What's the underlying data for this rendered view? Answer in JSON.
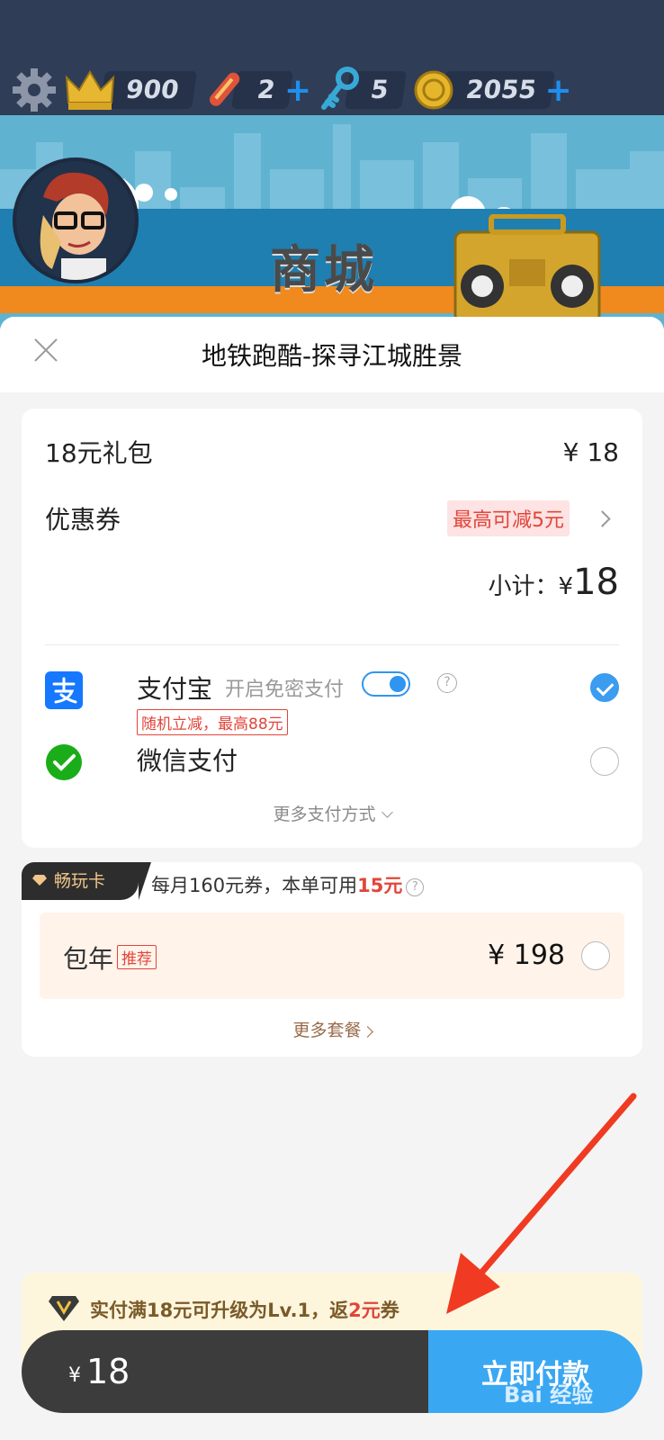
{
  "hud": {
    "crowns": "900",
    "boards": "2",
    "keys": "5",
    "coins": "2055",
    "plus": "+"
  },
  "game": {
    "shop_title": "商城"
  },
  "sheet": {
    "title": "地铁跑酷-探寻江城胜景",
    "item_name": "18元礼包",
    "item_price": "¥ 18",
    "coupon_label": "优惠券",
    "coupon_tag": "最高可减5元",
    "subtotal_label": "小计：¥",
    "subtotal_value": "18",
    "alipay_name": "支付宝",
    "alipay_sub": "开启免密支付",
    "alipay_promo": "随机立减，最高88元",
    "wechat_name": "微信支付",
    "more_pay": "更多支付方式"
  },
  "vip": {
    "badge": "畅玩卡",
    "desc_prefix": "每月160元券，本单可用",
    "desc_amount": "15元",
    "plan_name": "包年",
    "plan_tag": "推荐",
    "plan_price": "¥ 198",
    "more_plans": "更多套餐"
  },
  "bottom": {
    "upgrade_prefix": "实付满18元可升级为Lv.1，返",
    "upgrade_amount": "2元",
    "upgrade_suffix": "券",
    "currency": "¥",
    "total": "18",
    "pay_button": "立即付款"
  },
  "watermark": "Bai 经验",
  "colors": {
    "accent": "#3aa7f3",
    "promo_red": "#e2453a",
    "arrow": "#f03a22"
  }
}
